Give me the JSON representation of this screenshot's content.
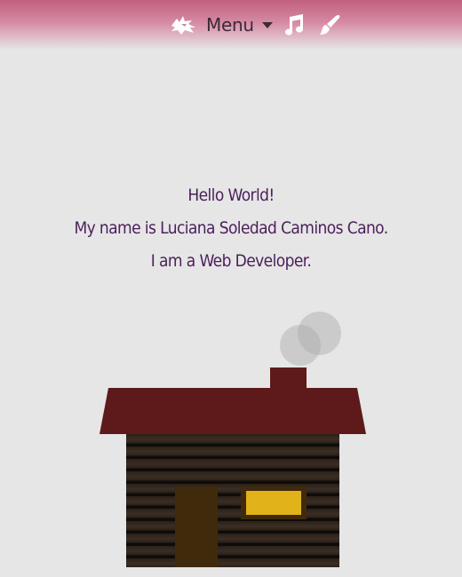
{
  "nav": {
    "logo_icon": "dragon-logo-icon",
    "menu_label": "Menu",
    "caret_icon": "caret-down-icon",
    "music_icon": "music-note-icon",
    "brush_icon": "paint-brush-icon",
    "colors": {
      "gradient_top": "#c0607f",
      "icon_color": "#ffffff"
    }
  },
  "greeting": {
    "line1": "Hello World!",
    "line2": "My name is Luciana Soledad Caminos Cano.",
    "line3": "I am a Web Developer.",
    "color": "#4a1f5a"
  },
  "cabin": {
    "roof_color": "#5e1a1a",
    "wall_color": "#2b2119",
    "door_color": "#3f2b0b",
    "window_color": "#e1b21a",
    "smoke_color": "#aaaaaa"
  }
}
